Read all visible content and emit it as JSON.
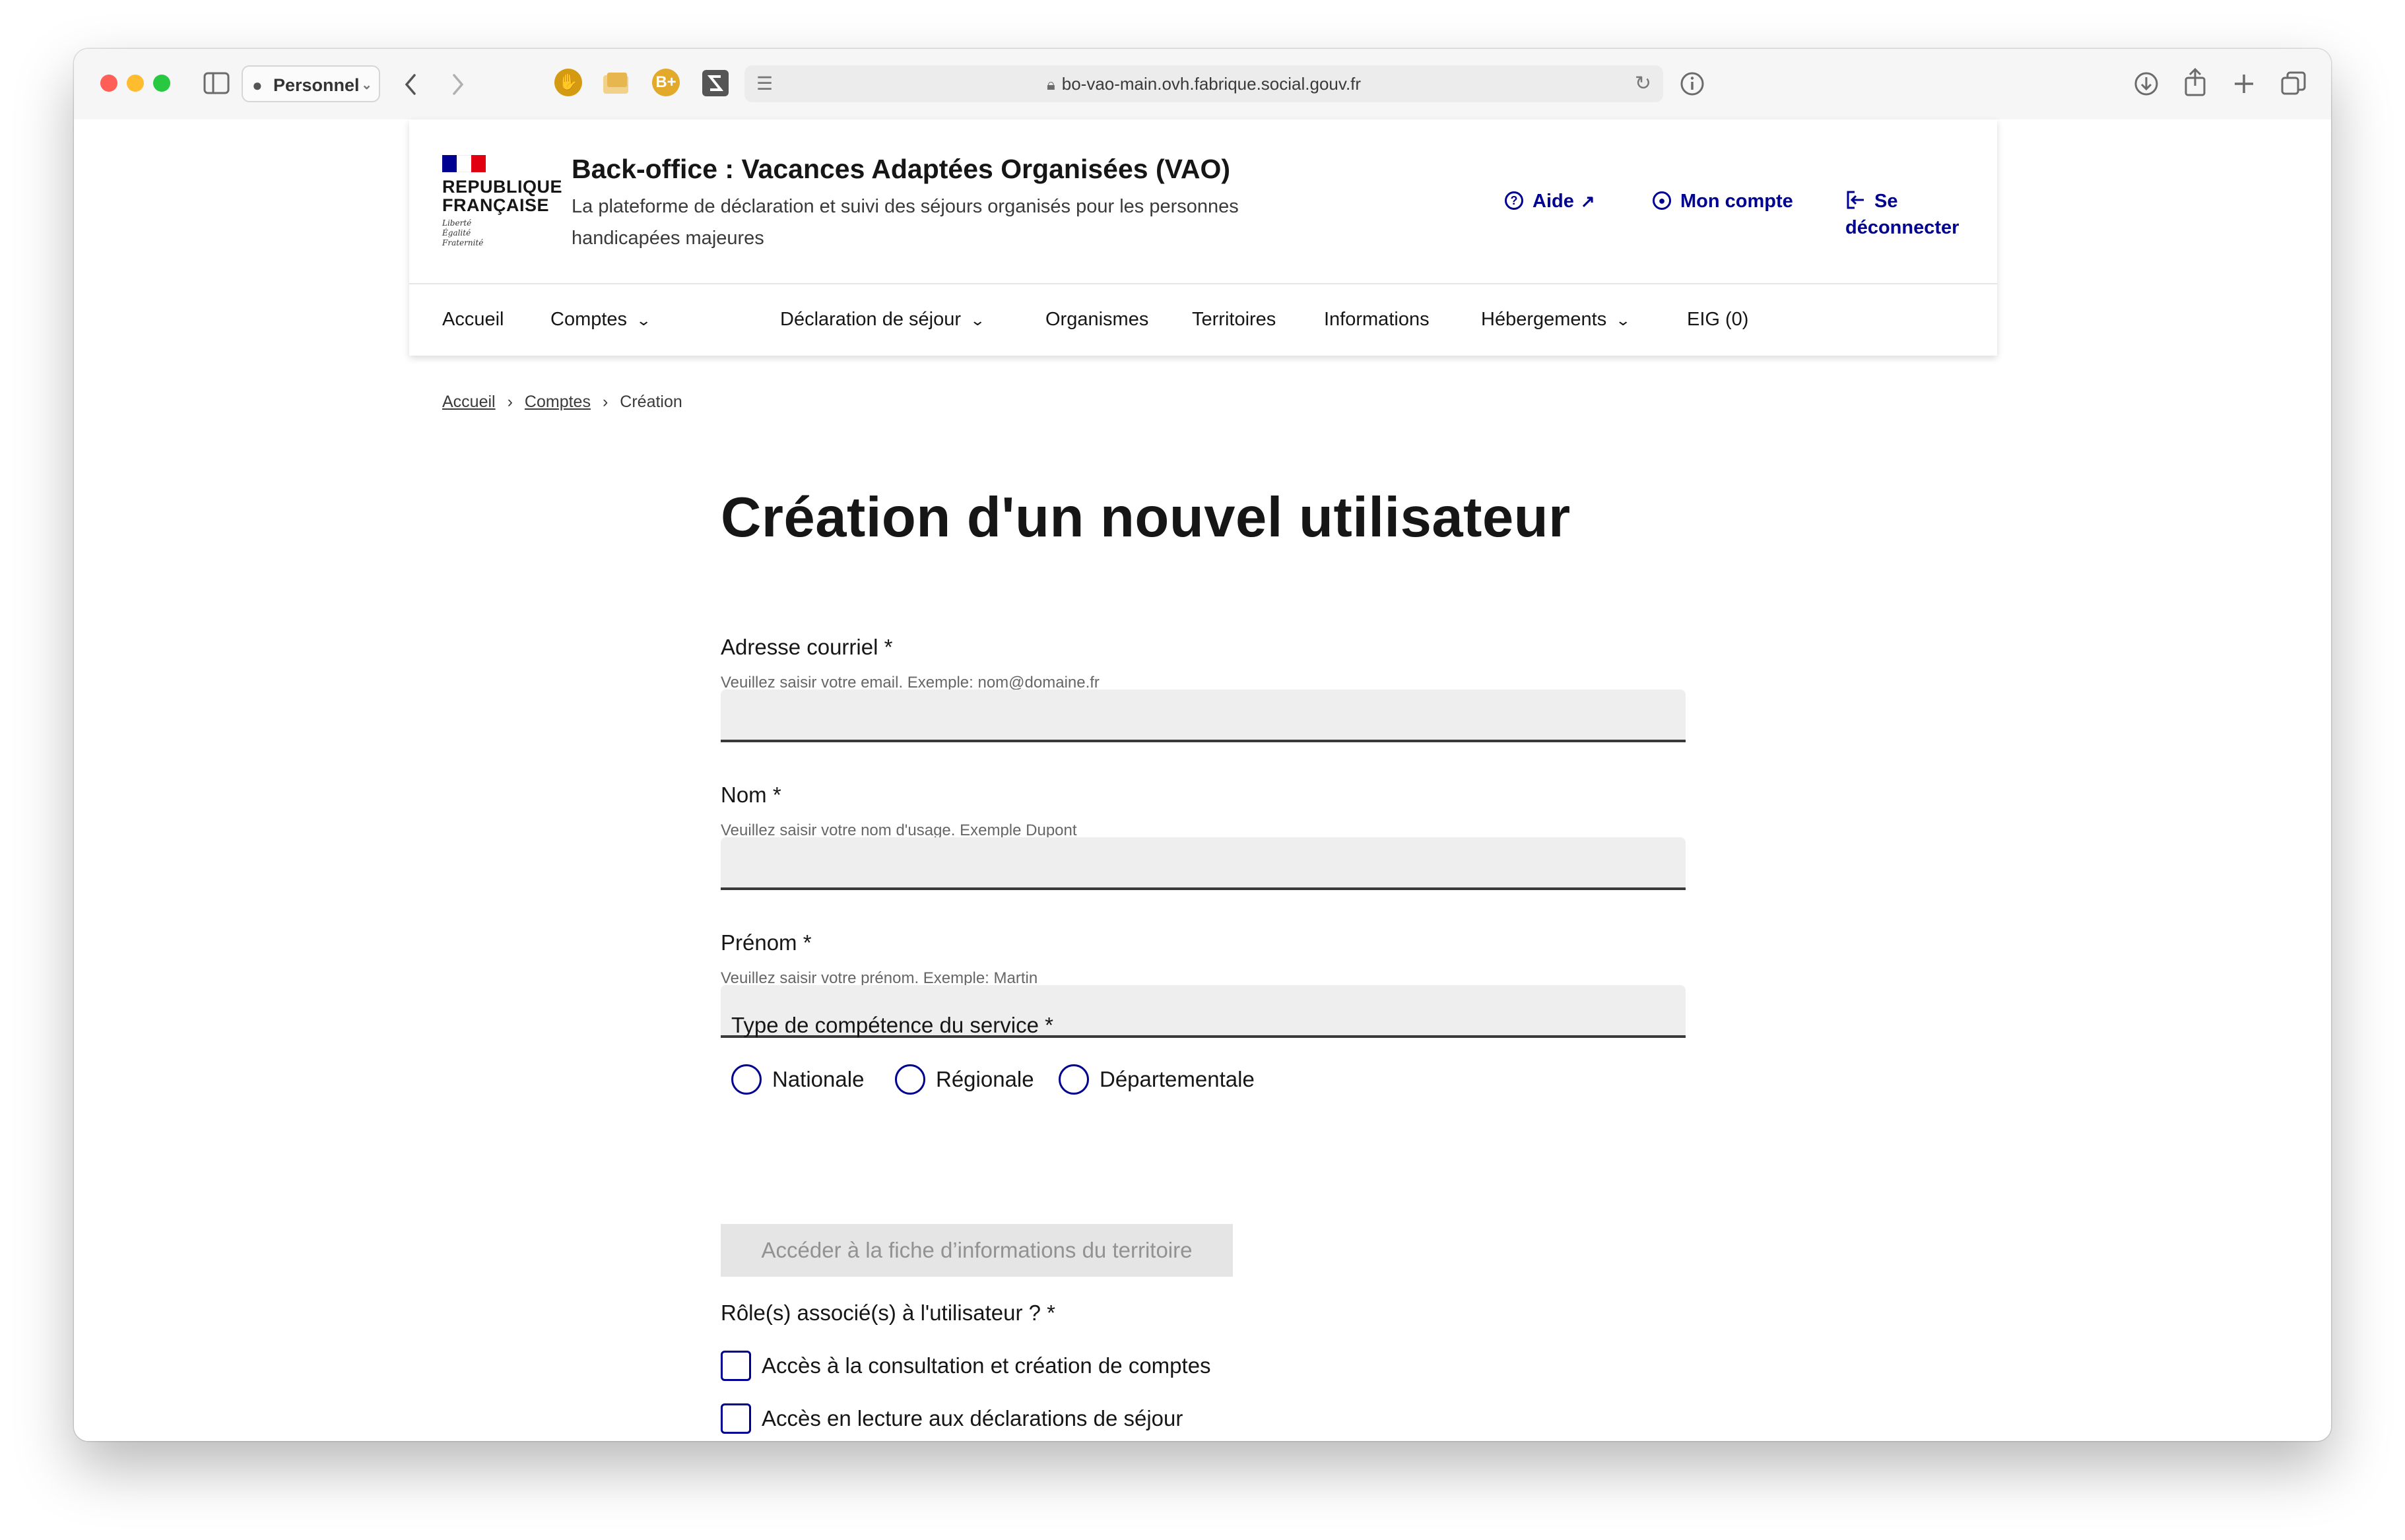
{
  "browser": {
    "profile": "Personnel",
    "url": "bo-vao-main.ovh.fabrique.social.gouv.fr",
    "extensions": [
      "B+"
    ]
  },
  "header": {
    "logo_text_1": "REPUBLIQUE",
    "logo_text_2": "FRANÇAISE",
    "motto": [
      "Liberté",
      "Égalité",
      "Fraternité"
    ],
    "service_title": "Back-office : Vacances Adaptées Organisées (VAO)",
    "service_tagline": "La plateforme de déclaration et suivi des séjours organisés pour les personnes handicapées majeures",
    "links": {
      "help": "Aide",
      "account": "Mon compte",
      "logout": "Se déconnecter"
    }
  },
  "nav": {
    "items": [
      {
        "label": "Accueil"
      },
      {
        "label": "Comptes"
      },
      {
        "label": "Déclaration de séjour"
      },
      {
        "label": "Organismes"
      },
      {
        "label": "Territoires"
      },
      {
        "label": "Informations"
      },
      {
        "label": "Hébergements"
      },
      {
        "label": "EIG (0)"
      }
    ]
  },
  "breadcrumb": [
    "Accueil",
    "Comptes",
    "Création"
  ],
  "form": {
    "title": "Création d'un nouvel utilisateur",
    "email": {
      "label": "Adresse courriel *",
      "hint": "Veuillez saisir votre email. Exemple: nom@domaine.fr",
      "value": ""
    },
    "nom": {
      "label": "Nom *",
      "hint": "Veuillez saisir votre nom d'usage. Exemple Dupont",
      "value": ""
    },
    "prenom": {
      "label": "Prénom *",
      "hint": "Veuillez saisir votre prénom. Exemple: Martin",
      "value": ""
    },
    "competence": {
      "label": "Type de compétence du service  *",
      "options": [
        "Nationale",
        "Régionale",
        "Départementale"
      ]
    },
    "territory_button": "Accéder à la fiche d’informations du territoire",
    "roles": {
      "label": "Rôle(s) associé(s) à l'utilisateur ?  *",
      "options": [
        "Accès à la consultation et création de comptes",
        "Accès en lecture aux déclarations de séjour"
      ]
    }
  },
  "colors": {
    "primary": "#000091",
    "flag_blue": "#000091",
    "flag_red": "#e1000f"
  }
}
